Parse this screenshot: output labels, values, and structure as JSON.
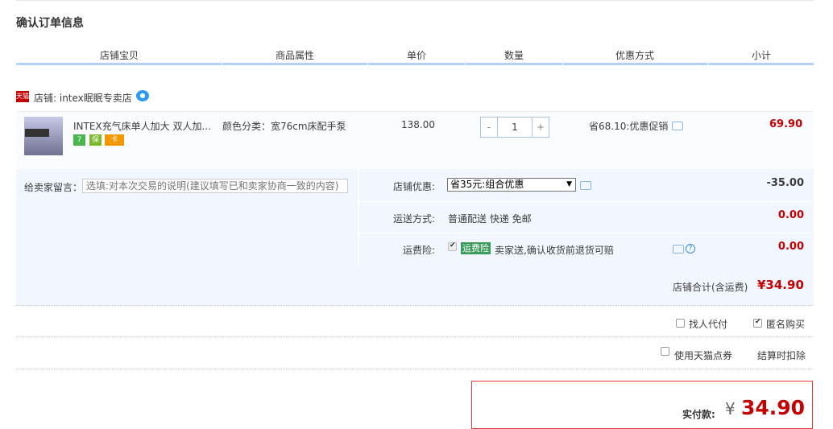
{
  "page": {
    "title": "确认订单信息"
  },
  "table_header": [
    "店铺宝贝",
    "商品属性",
    "单价",
    "数量",
    "优惠方式",
    "小计"
  ],
  "shop": {
    "label": "店铺: intex眠眠专卖店",
    "logo_text": "天猫"
  },
  "item": {
    "title": "INTEX充气床单人加大 双人加...",
    "sku": "颜色分类：宽76cm床配手泵",
    "price": "138.00",
    "quantity": "1",
    "minus": "-",
    "plus": "+",
    "promo": "省68.10:优惠促销",
    "subtotal": "69.90",
    "service_icons": [
      "7",
      "保",
      "卡"
    ]
  },
  "message": {
    "label": "给卖家留言：",
    "placeholder": "选填:对本次交易的说明(建议填写已和卖家协商一致的内容)"
  },
  "shop_discount": {
    "label": "店铺优惠:",
    "selected": "省35元:组合优惠",
    "amount": "-35.00"
  },
  "shipping": {
    "label": "运送方式:",
    "value": "普通配送 快递 免邮",
    "amount": "0.00"
  },
  "insurance": {
    "label": "运费险:",
    "badge": "运费险",
    "text": "卖家送,确认收货前退货可赔",
    "amount": "0.00"
  },
  "total": {
    "label": "店铺合计(含运费)",
    "value": "¥34.90"
  },
  "options": {
    "proxy_pay": "找人代付",
    "anonymous": "匿名购买",
    "tmall_points": "使用天猫点券",
    "deduct_note": "结算时扣除"
  },
  "payment": {
    "label": "实付款:",
    "currency": "¥",
    "value": "34.90"
  },
  "colors": {
    "accent": "#c40000",
    "header_bar": "#b2d1ff",
    "row_bg": "#f2f7ff"
  }
}
